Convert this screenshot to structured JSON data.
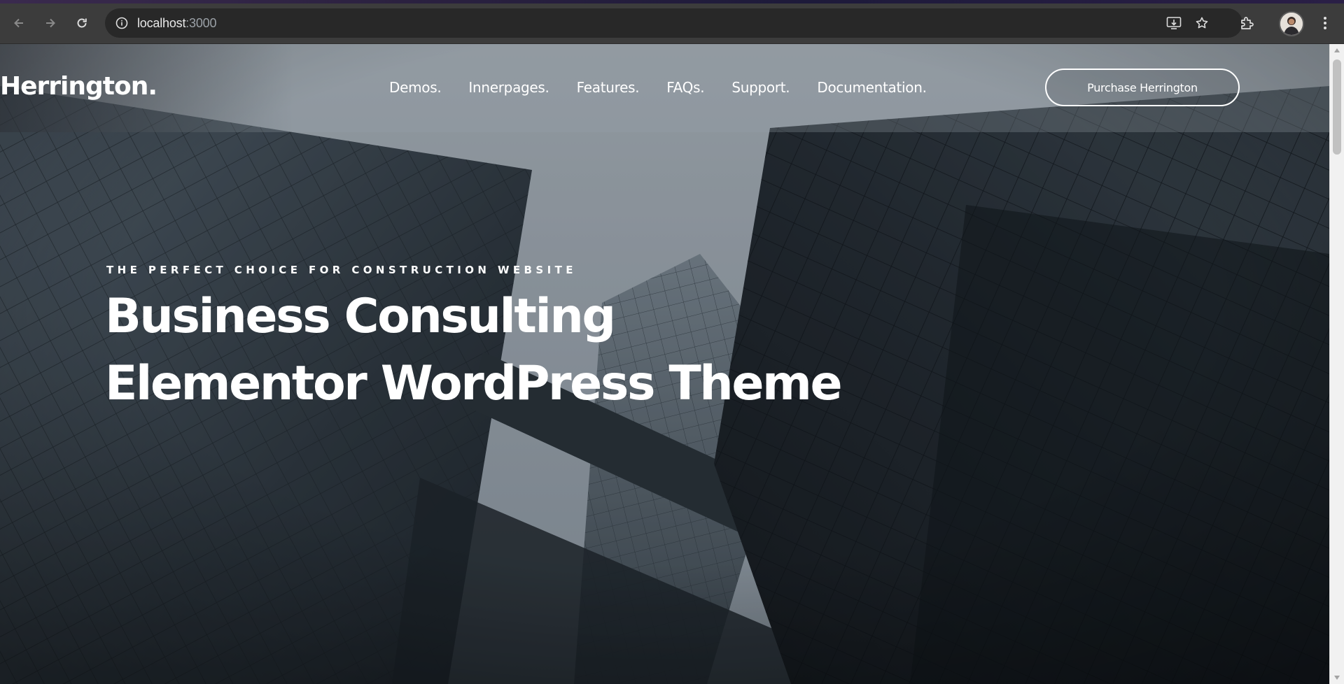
{
  "browser": {
    "url_host": "localhost",
    "url_port": ":3000",
    "toolbar_icons": [
      "back-arrow-icon",
      "forward-arrow-icon",
      "reload-icon",
      "site-info-icon",
      "install-app-icon",
      "bookmark-star-icon",
      "extensions-puzzle-icon",
      "profile-avatar",
      "kebab-menu-icon"
    ]
  },
  "site": {
    "logo": "Herrington.",
    "nav": [
      {
        "label": "Demos."
      },
      {
        "label": "Innerpages."
      },
      {
        "label": "Features."
      },
      {
        "label": "FAQs."
      },
      {
        "label": "Support."
      },
      {
        "label": "Documentation."
      }
    ],
    "cta_label": "Purchase Herrington",
    "accent_color": "#0b1018"
  },
  "hero": {
    "tagline": "THE PERFECT CHOICE FOR CONSTRUCTION WEBSITE",
    "title_line1": "Business Consulting",
    "title_line2": "Elementor WordPress Theme"
  }
}
